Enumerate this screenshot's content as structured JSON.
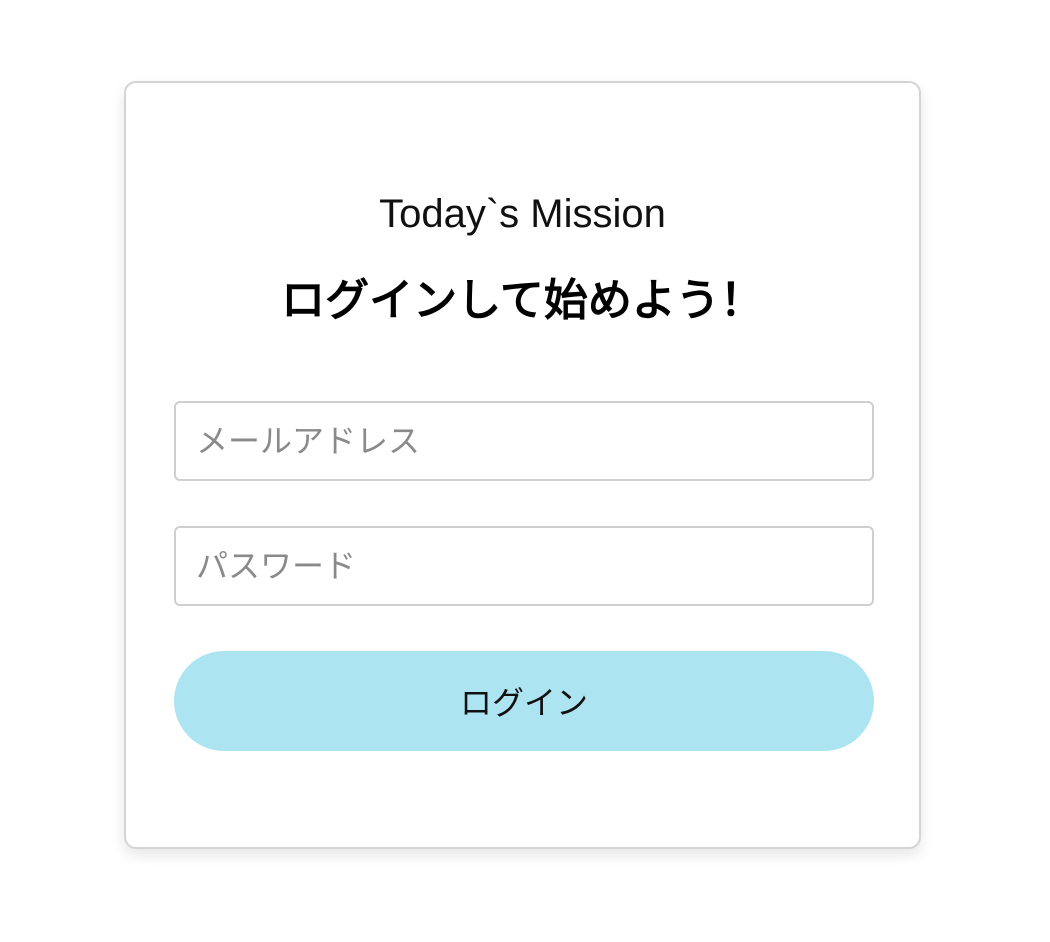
{
  "login_card": {
    "app_title": "Today`s Mission",
    "headline": "ログインして始めよう！",
    "email": {
      "placeholder": "メールアドレス",
      "value": ""
    },
    "password": {
      "placeholder": "パスワード",
      "value": ""
    },
    "login_button_label": "ログイン"
  },
  "colors": {
    "login_button_bg": "#ade4f1",
    "card_border": "#d4d4d4"
  }
}
